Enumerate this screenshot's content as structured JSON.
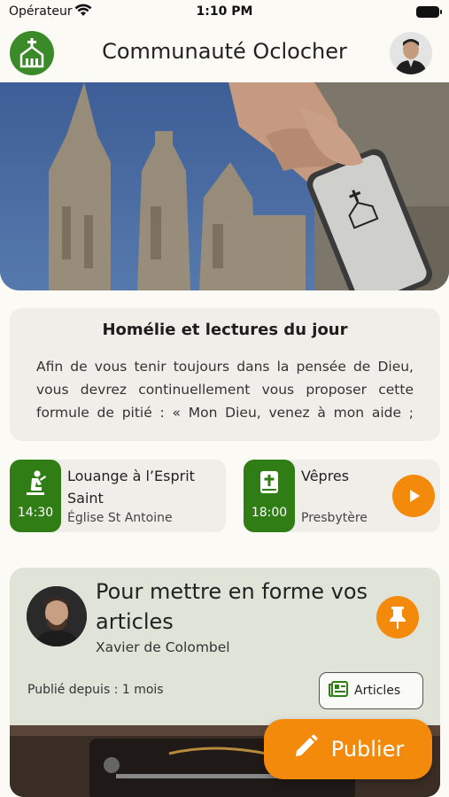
{
  "status_bar": {
    "carrier": "Opérateur",
    "time": "1:10 PM"
  },
  "header": {
    "title": "Communauté Oclocher"
  },
  "homily": {
    "title": "Homélie et lectures du jour",
    "text": "Afin de vous tenir toujours dans la pensée de Dieu, vous devrez continuellement vous proposer cette formule de pitié : « Mon Dieu, venez à mon aide ; hât…"
  },
  "events": [
    {
      "time": "14:30",
      "title": "Louange à l’Esprit Saint",
      "place": "Église St Antoine",
      "icon": "praying-person-icon"
    },
    {
      "time": "18:00",
      "title": "Vêpres",
      "place": "Presbytère",
      "icon": "bible-icon"
    }
  ],
  "post": {
    "title": "Pour mettre en forme vos articles",
    "author": "Xavier de Colombel",
    "published": "Publié depuis : 1 mois",
    "category": "Articles"
  },
  "fab": {
    "label": "Publier"
  },
  "colors": {
    "green": "#2f7d14",
    "orange": "#f48a0c",
    "card": "#efeee9",
    "post_card": "#dfe3d8"
  }
}
